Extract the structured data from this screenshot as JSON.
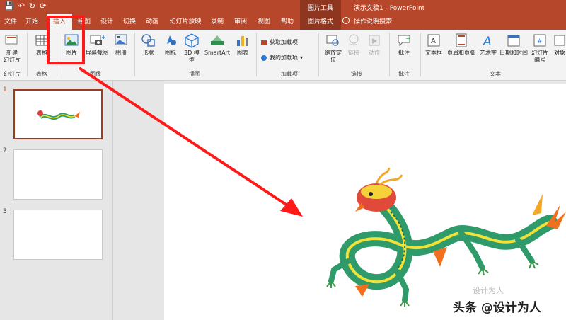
{
  "window": {
    "quick_access": [
      "💾",
      "↶",
      "↻",
      "⟳"
    ],
    "context_group": "图片工具",
    "doc_title": "演示文稿1  -  PowerPoint"
  },
  "tabs": [
    {
      "label": "文件"
    },
    {
      "label": "开始"
    },
    {
      "label": "插入",
      "active": true
    },
    {
      "label": "绘图"
    },
    {
      "label": "设计"
    },
    {
      "label": "切换"
    },
    {
      "label": "动画"
    },
    {
      "label": "幻灯片放映"
    },
    {
      "label": "录制"
    },
    {
      "label": "审阅"
    },
    {
      "label": "视图"
    },
    {
      "label": "帮助"
    },
    {
      "label": "图片格式"
    }
  ],
  "tell_me": "操作说明搜索",
  "ribbon": {
    "new_slide": {
      "line1": "新建",
      "line2": "幻灯片"
    },
    "table": "表格",
    "picture": "图片",
    "screenshot": "屏幕截图",
    "album": "相册",
    "shapes": "形状",
    "icons": "图标",
    "model3d": {
      "line1": "3D 模",
      "line2": "型"
    },
    "smartart": "SmartArt",
    "chart": "图表",
    "get_addins": "获取加载项",
    "my_addins": "我的加载项",
    "zoom": {
      "line1": "缩放定",
      "line2": "位"
    },
    "link": "链接",
    "action": "动作",
    "comment": "批注",
    "textbox": "文本框",
    "header_footer": "页眉和页脚",
    "wordart": "艺术字",
    "datetime": "日期和时间",
    "slide_number": {
      "line1": "幻灯片",
      "line2": "编号"
    },
    "object": "对象",
    "groups": {
      "slides": "幻灯片",
      "tables": "表格",
      "images": "图像",
      "illustrations": "插图",
      "addins": "加载项",
      "links": "链接",
      "comments": "批注",
      "text": "文本"
    }
  },
  "thumbnails": [
    "1",
    "2",
    "3"
  ],
  "watermark": "设计为人",
  "caption": "头条 @设计为人",
  "colors": {
    "accent": "#b7472a",
    "highlight": "#ff1a1a"
  }
}
